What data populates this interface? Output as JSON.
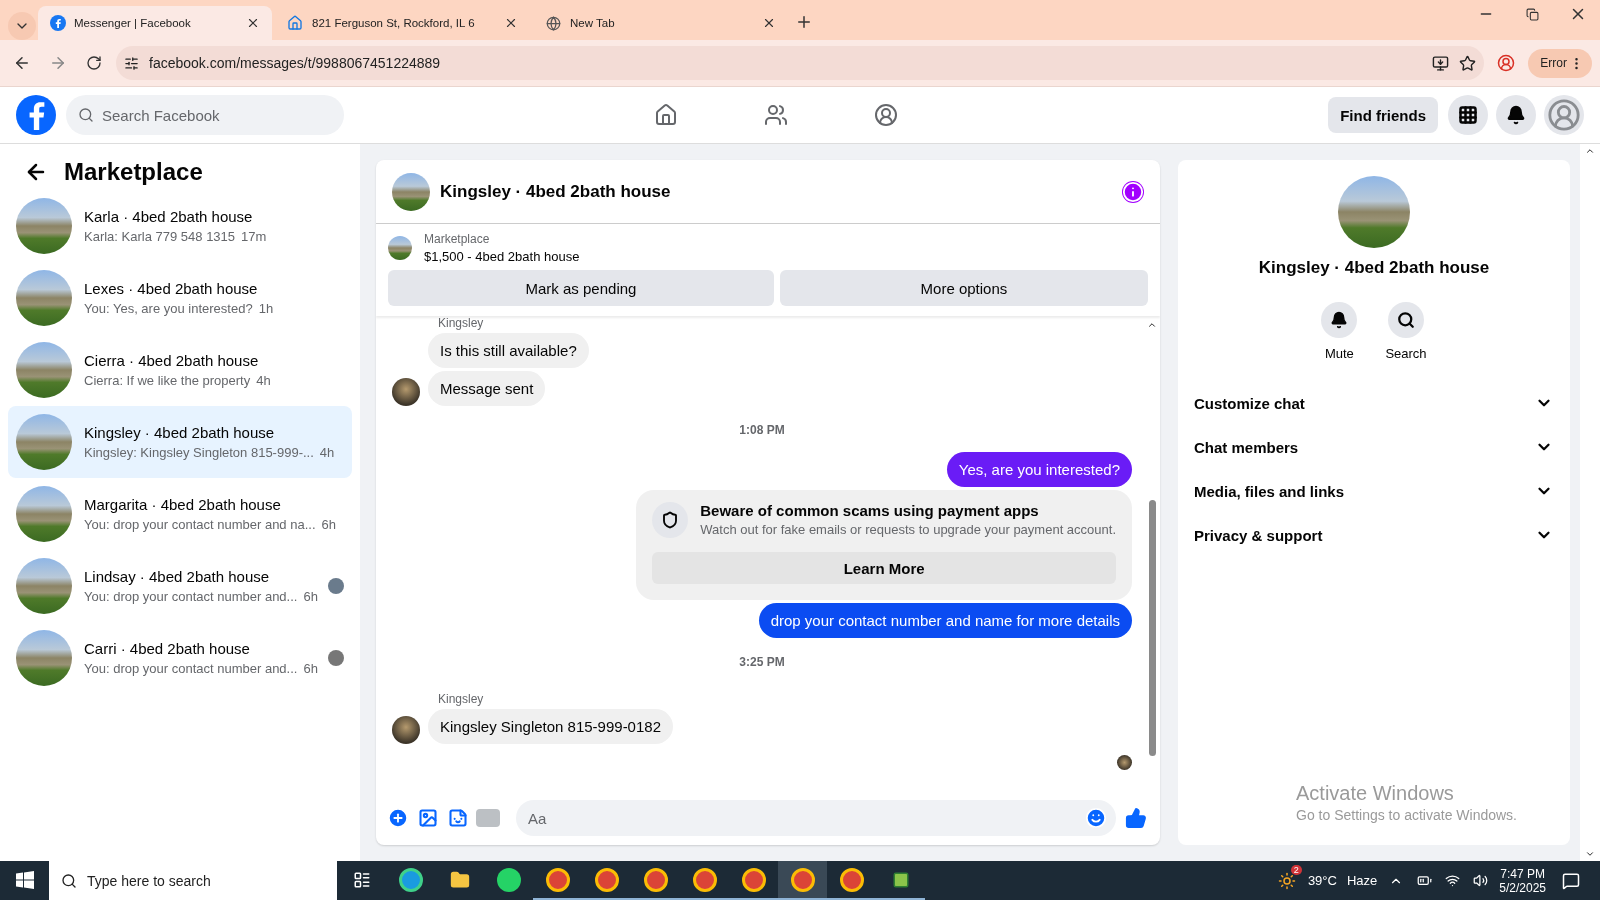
{
  "browser": {
    "tabs": [
      {
        "title": "Messenger | Facebook",
        "selected": true,
        "kind": "facebook"
      },
      {
        "title": "821 Ferguson St, Rockford, IL 6",
        "selected": false,
        "kind": "zillow"
      },
      {
        "title": "New Tab",
        "selected": false,
        "kind": "chrome"
      }
    ],
    "url": "facebook.com/messages/t/9988067451224889",
    "profile_status": "Error"
  },
  "header": {
    "search_placeholder": "Search Facebook",
    "find_friends": "Find friends"
  },
  "sidebar": {
    "title": "Marketplace",
    "conversations": [
      {
        "name": "Karla · 4bed 2bath house",
        "preview": "Karla: Karla 779 548 1315",
        "time": "17m",
        "selected": false,
        "seen_avatar": false
      },
      {
        "name": "Lexes · 4bed 2bath house",
        "preview": "You: Yes, are you interested?",
        "time": "1h",
        "selected": false,
        "seen_avatar": false
      },
      {
        "name": "Cierra · 4bed 2bath house",
        "preview": "Cierra: If we like the property",
        "time": "4h",
        "selected": false,
        "seen_avatar": false
      },
      {
        "name": "Kingsley · 4bed 2bath house",
        "preview": "Kingsley: Kingsley Singleton 815-999-...",
        "time": "4h",
        "selected": true,
        "seen_avatar": false
      },
      {
        "name": "Margarita · 4bed 2bath house",
        "preview": "You: drop your contact number and na...",
        "time": "6h",
        "selected": false,
        "seen_avatar": false
      },
      {
        "name": "Lindsay · 4bed 2bath house",
        "preview": "You: drop your contact number and...",
        "time": "6h",
        "selected": false,
        "seen_avatar": true
      },
      {
        "name": "Carri · 4bed 2bath house",
        "preview": "You: drop your contact number and...",
        "time": "6h",
        "selected": false,
        "seen_avatar": true
      }
    ]
  },
  "chat": {
    "title": "Kingsley · 4bed 2bath house",
    "listing_label": "Marketplace",
    "listing": "$1,500 - 4bed 2bath house",
    "buttons": [
      "Mark as pending",
      "More options"
    ],
    "messages": [
      {
        "kind": "sender",
        "text": "Kingsley"
      },
      {
        "kind": "incoming",
        "text": "Is this still available?",
        "avatar": false
      },
      {
        "kind": "incoming",
        "text": "Message sent",
        "avatar": true
      },
      {
        "kind": "timestamp",
        "text": "1:08 PM"
      },
      {
        "kind": "outgoing",
        "text": "Yes, are you interested?",
        "color": "#6a1cf6"
      },
      {
        "kind": "warning",
        "title": "Beware of common scams using payment apps",
        "text": "Watch out for fake emails or requests to upgrade your payment account.",
        "button": "Learn More"
      },
      {
        "kind": "outgoing",
        "text": "drop your contact number and name for more details",
        "color": "#0b4cf2"
      },
      {
        "kind": "timestamp",
        "text": "3:25 PM"
      },
      {
        "kind": "sender",
        "text": "Kingsley"
      },
      {
        "kind": "incoming",
        "text": "Kingsley Singleton 815-999-0182",
        "avatar": true
      },
      {
        "kind": "seen"
      }
    ],
    "composer_placeholder": "Aa"
  },
  "details": {
    "title": "Kingsley · 4bed 2bath house",
    "actions": [
      {
        "label": "Mute",
        "kind": "bell"
      },
      {
        "label": "Search",
        "kind": "search"
      }
    ],
    "sections": [
      {
        "label": "Customize chat",
        "expanded": false
      },
      {
        "label": "Chat members",
        "expanded": false
      },
      {
        "label": "Media, files and links",
        "expanded": false
      },
      {
        "label": "Privacy & support",
        "expanded": false
      }
    ]
  },
  "activation": {
    "title": "Activate Windows",
    "text": "Go to Settings to activate Windows."
  },
  "taskbar": {
    "search_placeholder": "Type here to search",
    "weather_badge": "2",
    "temperature": "39°C",
    "weather": "Haze",
    "time": "7:47 PM",
    "date": "5/2/2025"
  }
}
